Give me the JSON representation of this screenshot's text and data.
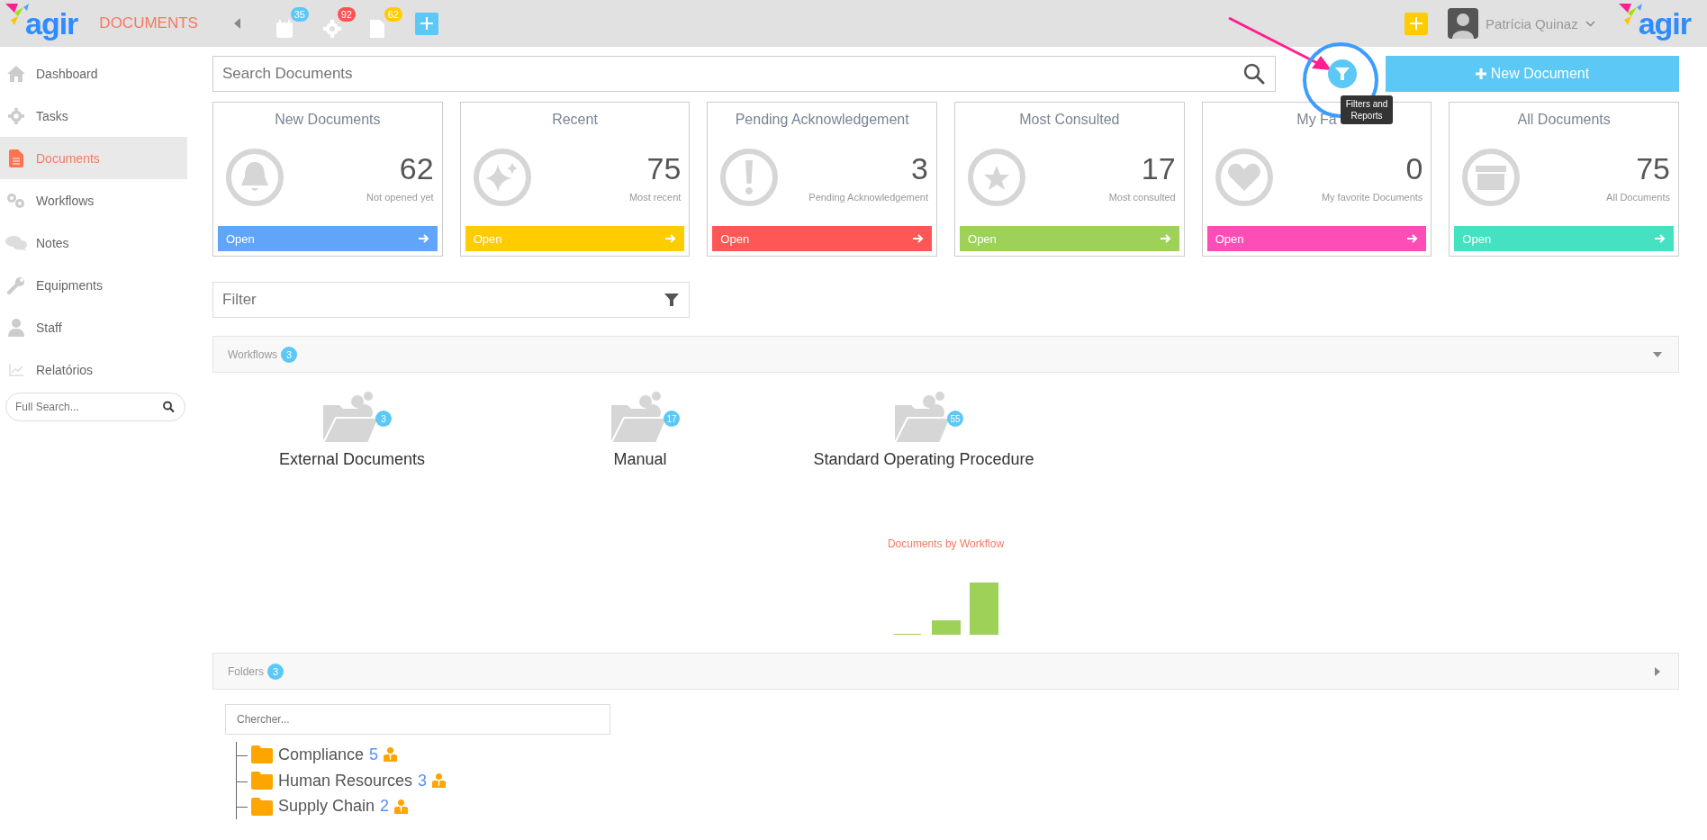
{
  "topbar": {
    "logo": "agir",
    "app_title": "DOCUMENTS",
    "counters": [
      {
        "kind": "calendar",
        "count": "35",
        "color": "#5bc8f5"
      },
      {
        "kind": "gear",
        "count": "92",
        "color": "#ff5252"
      },
      {
        "kind": "document",
        "count": "62",
        "color": "#ffcc00"
      }
    ],
    "user": {
      "name": "Patrícia Quinaz"
    },
    "logo_right": "agir"
  },
  "sidebar": {
    "items": [
      {
        "label": "Dashboard",
        "kind": "home",
        "selected": false
      },
      {
        "label": "Tasks",
        "kind": "gear",
        "selected": false
      },
      {
        "label": "Documents",
        "kind": "document",
        "selected": true
      },
      {
        "label": "Workflows",
        "kind": "gears",
        "selected": false
      },
      {
        "label": "Notes",
        "kind": "chat",
        "selected": false
      },
      {
        "label": "Equipments",
        "kind": "wrench",
        "selected": false
      },
      {
        "label": "Staff",
        "kind": "person",
        "selected": false
      },
      {
        "label": "Relatórios",
        "kind": "chart",
        "selected": false
      }
    ],
    "search": {
      "placeholder": "Full Search..."
    }
  },
  "search": {
    "placeholder": "Search Documents"
  },
  "filter_button": {
    "tooltip": "Filters and Reports"
  },
  "new_button": {
    "label": "New Document"
  },
  "cards": [
    {
      "title": "New Documents",
      "count": "62",
      "subtitle": "Not opened yet",
      "action": "Open",
      "color": "#61a5fa",
      "kind": "bell"
    },
    {
      "title": "Recent",
      "count": "75",
      "subtitle": "Most recent",
      "action": "Open",
      "color": "#ffcc00",
      "kind": "sparkle"
    },
    {
      "title": "Pending Acknowledgement",
      "count": "3",
      "subtitle": "Pending Acknowledgement",
      "action": "Open",
      "color": "#ff5656",
      "kind": "exclamation"
    },
    {
      "title": "Most Consulted",
      "count": "17",
      "subtitle": "Most consulted",
      "action": "Open",
      "color": "#9dd158",
      "kind": "star"
    },
    {
      "title": "My Fa",
      "count": "0",
      "subtitle": "My favorite Documents",
      "action": "Open",
      "color": "#ff4db8",
      "kind": "heart"
    },
    {
      "title": "All Documents",
      "count": "75",
      "subtitle": "All Documents",
      "action": "Open",
      "color": "#45e2c1",
      "kind": "archive"
    }
  ],
  "filter": {
    "placeholder": "Filter"
  },
  "workflows": {
    "title": "Workflows",
    "count": "3",
    "expanded": true,
    "items": [
      {
        "name": "External Documents",
        "count": "3"
      },
      {
        "name": "Manual",
        "count": "17"
      },
      {
        "name": "Standard Operating Procedure",
        "count": "55"
      }
    ],
    "chart_title": "Documents by Workflow"
  },
  "folders": {
    "title": "Folders",
    "count": "3",
    "expanded": false,
    "search": {
      "placeholder": "Chercher..."
    },
    "items": [
      {
        "name": "Compliance",
        "count": "5"
      },
      {
        "name": "Human Resources",
        "count": "3"
      },
      {
        "name": "Supply Chain",
        "count": "2"
      }
    ]
  }
}
